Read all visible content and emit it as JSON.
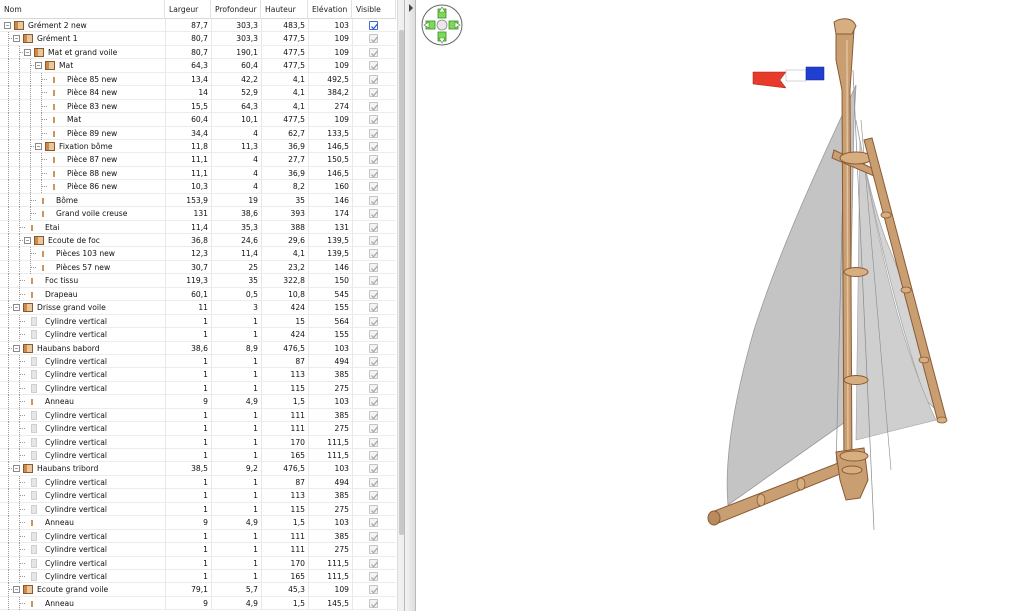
{
  "columns": {
    "name": "Nom",
    "width": "Largeur",
    "depth": "Profondeur",
    "height": "Hauteur",
    "elevation": "Elévation",
    "visible": "Visible"
  },
  "rows": [
    {
      "name": "Grément 2 new",
      "level": 0,
      "kind": "group",
      "expander": "minus",
      "l": "87,7",
      "p": "303,3",
      "h": "483,5",
      "e": "103",
      "visible": true,
      "top": true
    },
    {
      "name": "Grément 1",
      "level": 1,
      "kind": "group",
      "expander": "minus",
      "l": "80,7",
      "p": "303,3",
      "h": "477,5",
      "e": "109",
      "visible": true
    },
    {
      "name": "Mat et grand voile",
      "level": 2,
      "kind": "group",
      "expander": "minus",
      "l": "80,7",
      "p": "190,1",
      "h": "477,5",
      "e": "109",
      "visible": true
    },
    {
      "name": "Mat",
      "level": 3,
      "kind": "group",
      "expander": "minus",
      "l": "64,3",
      "p": "60,4",
      "h": "477,5",
      "e": "109",
      "visible": true
    },
    {
      "name": "Pièce 85 new",
      "level": 4,
      "kind": "piece",
      "l": "13,4",
      "p": "42,2",
      "h": "4,1",
      "e": "492,5",
      "visible": true
    },
    {
      "name": "Pièce 84 new",
      "level": 4,
      "kind": "piece",
      "l": "14",
      "p": "52,9",
      "h": "4,1",
      "e": "384,2",
      "visible": true
    },
    {
      "name": "Pièce 83 new",
      "level": 4,
      "kind": "piece",
      "l": "15,5",
      "p": "64,3",
      "h": "4,1",
      "e": "274",
      "visible": true
    },
    {
      "name": "Mat",
      "level": 4,
      "kind": "piece",
      "l": "60,4",
      "p": "10,1",
      "h": "477,5",
      "e": "109",
      "visible": true
    },
    {
      "name": "Pièce 89 new",
      "level": 4,
      "kind": "piece",
      "l": "34,4",
      "p": "4",
      "h": "62,7",
      "e": "133,5",
      "visible": true
    },
    {
      "name": "Fixation bôme",
      "level": 3,
      "kind": "group",
      "expander": "minus",
      "l": "11,8",
      "p": "11,3",
      "h": "36,9",
      "e": "146,5",
      "visible": true
    },
    {
      "name": "Pièce 87 new",
      "level": 4,
      "kind": "piece",
      "l": "11,1",
      "p": "4",
      "h": "27,7",
      "e": "150,5",
      "visible": true
    },
    {
      "name": "Pièce 88 new",
      "level": 4,
      "kind": "piece",
      "l": "11,1",
      "p": "4",
      "h": "36,9",
      "e": "146,5",
      "visible": true
    },
    {
      "name": "Pièce 86 new",
      "level": 4,
      "kind": "piece",
      "l": "10,3",
      "p": "4",
      "h": "8,2",
      "e": "160",
      "visible": true
    },
    {
      "name": "Bôme",
      "level": 3,
      "kind": "piece",
      "l": "153,9",
      "p": "19",
      "h": "35",
      "e": "146",
      "visible": true
    },
    {
      "name": "Grand voile creuse",
      "level": 3,
      "kind": "piece",
      "l": "131",
      "p": "38,6",
      "h": "393",
      "e": "174",
      "visible": true
    },
    {
      "name": "Etai",
      "level": 2,
      "kind": "piece",
      "l": "11,4",
      "p": "35,3",
      "h": "388",
      "e": "131",
      "visible": true
    },
    {
      "name": "Ecoute de foc",
      "level": 2,
      "kind": "group",
      "expander": "minus",
      "l": "36,8",
      "p": "24,6",
      "h": "29,6",
      "e": "139,5",
      "visible": true
    },
    {
      "name": "Pièces 103 new",
      "level": 3,
      "kind": "piece",
      "l": "12,3",
      "p": "11,4",
      "h": "4,1",
      "e": "139,5",
      "visible": true
    },
    {
      "name": "Pièces 57 new",
      "level": 3,
      "kind": "piece",
      "l": "30,7",
      "p": "25",
      "h": "23,2",
      "e": "146",
      "visible": true
    },
    {
      "name": "Foc tissu",
      "level": 2,
      "kind": "piece",
      "l": "119,3",
      "p": "35",
      "h": "322,8",
      "e": "150",
      "visible": true
    },
    {
      "name": "Drapeau",
      "level": 2,
      "kind": "piece",
      "l": "60,1",
      "p": "0,5",
      "h": "10,8",
      "e": "545",
      "visible": true
    },
    {
      "name": "Drisse grand voile",
      "level": 1,
      "kind": "group",
      "expander": "minus",
      "l": "11",
      "p": "3",
      "h": "424",
      "e": "155",
      "visible": true
    },
    {
      "name": "Cylindre vertical",
      "level": 2,
      "kind": "cyl",
      "l": "1",
      "p": "1",
      "h": "15",
      "e": "564",
      "visible": true
    },
    {
      "name": "Cylindre vertical",
      "level": 2,
      "kind": "cyl",
      "l": "1",
      "p": "1",
      "h": "424",
      "e": "155",
      "visible": true
    },
    {
      "name": "Haubans babord",
      "level": 1,
      "kind": "group",
      "expander": "minus",
      "l": "38,6",
      "p": "8,9",
      "h": "476,5",
      "e": "103",
      "visible": true
    },
    {
      "name": "Cylindre vertical",
      "level": 2,
      "kind": "cyl",
      "l": "1",
      "p": "1",
      "h": "87",
      "e": "494",
      "visible": true
    },
    {
      "name": "Cylindre vertical",
      "level": 2,
      "kind": "cyl",
      "l": "1",
      "p": "1",
      "h": "113",
      "e": "385",
      "visible": true
    },
    {
      "name": "Cylindre vertical",
      "level": 2,
      "kind": "cyl",
      "l": "1",
      "p": "1",
      "h": "115",
      "e": "275",
      "visible": true
    },
    {
      "name": "Anneau",
      "level": 2,
      "kind": "piece",
      "l": "9",
      "p": "4,9",
      "h": "1,5",
      "e": "103",
      "visible": true
    },
    {
      "name": "Cylindre vertical",
      "level": 2,
      "kind": "cyl",
      "l": "1",
      "p": "1",
      "h": "111",
      "e": "385",
      "visible": true
    },
    {
      "name": "Cylindre vertical",
      "level": 2,
      "kind": "cyl",
      "l": "1",
      "p": "1",
      "h": "111",
      "e": "275",
      "visible": true
    },
    {
      "name": "Cylindre vertical",
      "level": 2,
      "kind": "cyl",
      "l": "1",
      "p": "1",
      "h": "170",
      "e": "111,5",
      "visible": true
    },
    {
      "name": "Cylindre vertical",
      "level": 2,
      "kind": "cyl",
      "l": "1",
      "p": "1",
      "h": "165",
      "e": "111,5",
      "visible": true
    },
    {
      "name": "Haubans tribord",
      "level": 1,
      "kind": "group",
      "expander": "minus",
      "l": "38,5",
      "p": "9,2",
      "h": "476,5",
      "e": "103",
      "visible": true
    },
    {
      "name": "Cylindre vertical",
      "level": 2,
      "kind": "cyl",
      "l": "1",
      "p": "1",
      "h": "87",
      "e": "494",
      "visible": true
    },
    {
      "name": "Cylindre vertical",
      "level": 2,
      "kind": "cyl",
      "l": "1",
      "p": "1",
      "h": "113",
      "e": "385",
      "visible": true
    },
    {
      "name": "Cylindre vertical",
      "level": 2,
      "kind": "cyl",
      "l": "1",
      "p": "1",
      "h": "115",
      "e": "275",
      "visible": true
    },
    {
      "name": "Anneau",
      "level": 2,
      "kind": "piece",
      "l": "9",
      "p": "4,9",
      "h": "1,5",
      "e": "103",
      "visible": true
    },
    {
      "name": "Cylindre vertical",
      "level": 2,
      "kind": "cyl",
      "l": "1",
      "p": "1",
      "h": "111",
      "e": "385",
      "visible": true
    },
    {
      "name": "Cylindre vertical",
      "level": 2,
      "kind": "cyl",
      "l": "1",
      "p": "1",
      "h": "111",
      "e": "275",
      "visible": true
    },
    {
      "name": "Cylindre vertical",
      "level": 2,
      "kind": "cyl",
      "l": "1",
      "p": "1",
      "h": "170",
      "e": "111,5",
      "visible": true
    },
    {
      "name": "Cylindre vertical",
      "level": 2,
      "kind": "cyl",
      "l": "1",
      "p": "1",
      "h": "165",
      "e": "111,5",
      "visible": true
    },
    {
      "name": "Ecoute grand voile",
      "level": 1,
      "kind": "group",
      "expander": "minus",
      "l": "79,1",
      "p": "5,7",
      "h": "45,3",
      "e": "109",
      "visible": true
    },
    {
      "name": "Anneau",
      "level": 2,
      "kind": "piece",
      "l": "9",
      "p": "4,9",
      "h": "1,5",
      "e": "145,5",
      "visible": true
    }
  ],
  "viewport": {
    "navigation": "pan-arrows-icon",
    "model": "sailboat-rigging-model",
    "colors": {
      "wood": "#c99f72",
      "wood_dark": "#8a5a36",
      "sail": "#bdbdbd",
      "flag_red": "#e83a2a",
      "flag_blue": "#1f3fd0",
      "nav_green": "#7ed957"
    }
  }
}
